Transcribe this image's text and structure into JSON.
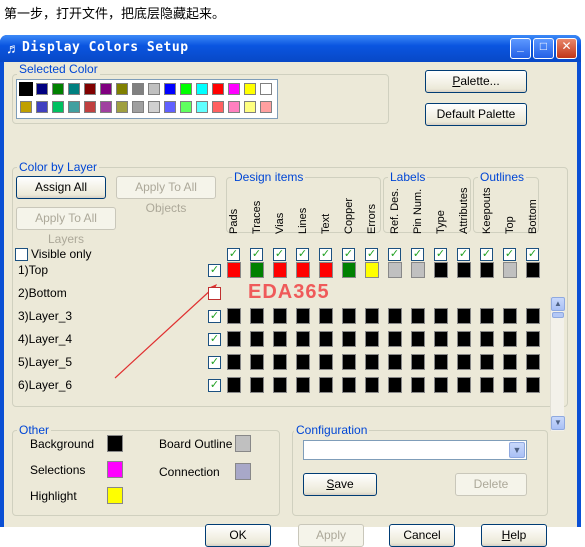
{
  "caption": "第一步，打开文件，把底层隐藏起来。",
  "window": {
    "title": "Display Colors Setup",
    "controls": [
      "minimize-icon",
      "maximize-icon",
      "close-icon"
    ]
  },
  "selected_color": {
    "label": "Selected Color",
    "palette_button": "Palette...",
    "default_palette_button": "Default Palette",
    "swatches": [
      "#000000",
      "#000080",
      "#008000",
      "#008080",
      "#800000",
      "#800080",
      "#808000",
      "#808080",
      "#c0c0c0",
      "#0000ff",
      "#00ff00",
      "#00ffff",
      "#ff0000",
      "#ff00ff",
      "#ffff00",
      "#ffffff",
      "#c0a000",
      "#4040c0",
      "#00c060",
      "#40a0a0",
      "#c04040",
      "#a040a0",
      "#a0a040",
      "#a0a0a0",
      "#d0d0d0",
      "#6060ff",
      "#60ff60",
      "#60ffff",
      "#ff6060",
      "#ff80c0",
      "#ffff80",
      "#ffa0a0"
    ]
  },
  "color_by_layer": {
    "label": "Color by Layer",
    "assign_all": "Assign All",
    "apply_to_all_objects": "Apply To All Objects",
    "apply_to_all_layers": "Apply To All Layers",
    "visible_only": "Visible only",
    "groups": {
      "design_items": "Design items",
      "labels": "Labels",
      "outlines": "Outlines"
    },
    "columns": [
      "Pads",
      "Traces",
      "Vias",
      "Lines",
      "Text",
      "Copper",
      "Errors",
      "Ref. Des.",
      "Pin Num.",
      "Type",
      "Attributes",
      "Keepouts",
      "Top",
      "Bottom"
    ],
    "layers": [
      {
        "label": "1)Top",
        "visible": true,
        "colors": [
          "#ff0000",
          "#008000",
          "#ff0000",
          "#ff0000",
          "#ff0000",
          "#008000",
          "#ffff00",
          "#c0c0c0",
          "#c0c0c0",
          "#000000",
          "#000000",
          "#000000",
          "#c0c0c0",
          "#000000"
        ]
      },
      {
        "label": "2)Bottom",
        "visible": false,
        "colors": []
      },
      {
        "label": "3)Layer_3",
        "visible": true,
        "colors": [
          "#000000",
          "#000000",
          "#000000",
          "#000000",
          "#000000",
          "#000000",
          "#000000",
          "#000000",
          "#000000",
          "#000000",
          "#000000",
          "#000000",
          "#000000",
          "#000000"
        ]
      },
      {
        "label": "4)Layer_4",
        "visible": true,
        "colors": [
          "#000000",
          "#000000",
          "#000000",
          "#000000",
          "#000000",
          "#000000",
          "#000000",
          "#000000",
          "#000000",
          "#000000",
          "#000000",
          "#000000",
          "#000000",
          "#000000"
        ]
      },
      {
        "label": "5)Layer_5",
        "visible": true,
        "colors": [
          "#000000",
          "#000000",
          "#000000",
          "#000000",
          "#000000",
          "#000000",
          "#000000",
          "#000000",
          "#000000",
          "#000000",
          "#000000",
          "#000000",
          "#000000",
          "#000000"
        ]
      },
      {
        "label": "6)Layer_6",
        "visible": true,
        "colors": [
          "#000000",
          "#000000",
          "#000000",
          "#000000",
          "#000000",
          "#000000",
          "#000000",
          "#000000",
          "#000000",
          "#000000",
          "#000000",
          "#000000",
          "#000000",
          "#000000"
        ]
      }
    ]
  },
  "watermark": "EDA365",
  "other": {
    "label": "Other",
    "background": {
      "label": "Background",
      "color": "#000000"
    },
    "selections": {
      "label": "Selections",
      "color": "#ff00ff"
    },
    "highlight": {
      "label": "Highlight",
      "color": "#ffff00"
    },
    "board_outline": {
      "label": "Board Outline",
      "color": "#c0c0c0"
    },
    "connection": {
      "label": "Connection",
      "color": "#a8a8c8"
    }
  },
  "configuration": {
    "label": "Configuration",
    "value": "",
    "save": "Save",
    "delete": "Delete"
  },
  "footer": {
    "ok": "OK",
    "apply": "Apply",
    "cancel": "Cancel",
    "help": "Help"
  }
}
